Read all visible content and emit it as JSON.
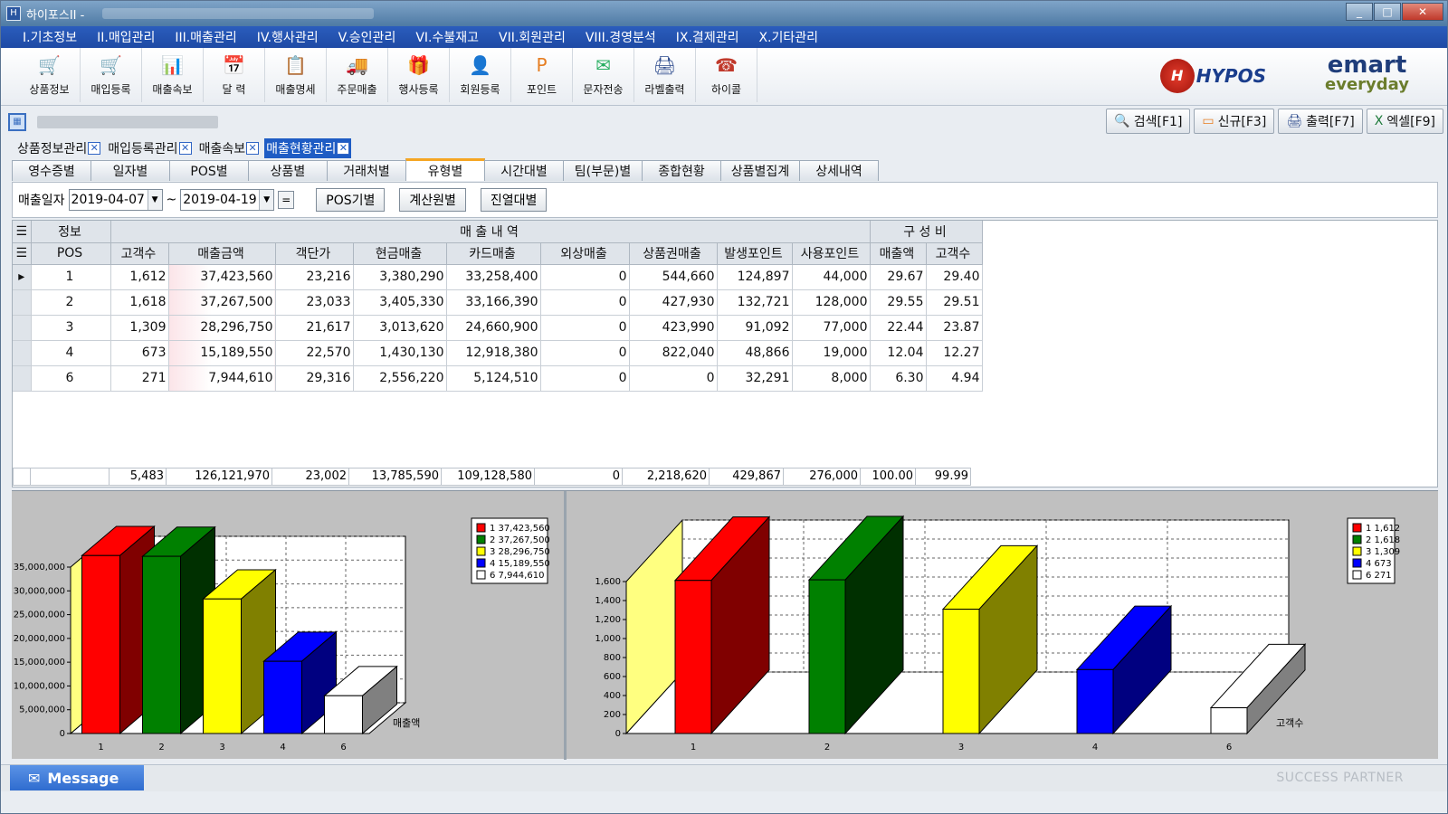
{
  "window": {
    "title": "하이포스II -",
    "controls": [
      "minimize",
      "maximize",
      "close"
    ]
  },
  "menu": [
    "I.기초정보",
    "II.매입관리",
    "III.매출관리",
    "IV.행사관리",
    "V.승인관리",
    "VI.수불재고",
    "VII.회원관리",
    "VIII.경영분석",
    "IX.결제관리",
    "X.기타관리"
  ],
  "toolbar": [
    {
      "label": "상품정보",
      "icon": "shop-basket-icon",
      "glyph": "🛒"
    },
    {
      "label": "매입등록",
      "icon": "cart-icon",
      "glyph": "🛒"
    },
    {
      "label": "매출속보",
      "icon": "chart-icon",
      "glyph": "📊"
    },
    {
      "label": "달  력",
      "icon": "calendar-icon",
      "glyph": "📅"
    },
    {
      "label": "매출명세",
      "icon": "clipboard-icon",
      "glyph": "📋"
    },
    {
      "label": "주문매출",
      "icon": "truck-icon",
      "glyph": "🚚"
    },
    {
      "label": "행사등록",
      "icon": "gift-icon",
      "glyph": "🎁"
    },
    {
      "label": "회원등록",
      "icon": "user-add-icon",
      "glyph": "👤"
    },
    {
      "label": "포인트",
      "icon": "point-coin-icon",
      "glyph": "P"
    },
    {
      "label": "문자전송",
      "icon": "envelope-icon",
      "glyph": "✉"
    },
    {
      "label": "라벨출력",
      "icon": "printer-icon",
      "glyph": "🖨"
    },
    {
      "label": "하이콜",
      "icon": "phone-icon",
      "glyph": "☎"
    }
  ],
  "logos": {
    "hypos_mark": "H",
    "hypos_text": "HYPOS",
    "emart_top": "emart",
    "emart_bottom": "everyday"
  },
  "actions": [
    {
      "label": "검색[F1]",
      "icon": "search-icon",
      "glyph": "🔍"
    },
    {
      "label": "신규[F3]",
      "icon": "new-doc-icon",
      "glyph": "▭"
    },
    {
      "label": "출력[F7]",
      "icon": "printer-icon",
      "glyph": "🖨"
    },
    {
      "label": "엑셀[F9]",
      "icon": "excel-icon",
      "glyph": "X"
    }
  ],
  "doc_tabs": [
    {
      "label": "상품정보관리",
      "active": false
    },
    {
      "label": "매입등록관리",
      "active": false
    },
    {
      "label": "매출속보",
      "active": false
    },
    {
      "label": "매출현황관리",
      "active": true
    }
  ],
  "sub_tabs": [
    {
      "label": "영수증별",
      "active": false
    },
    {
      "label": "일자별",
      "active": false
    },
    {
      "label": "POS별",
      "active": false
    },
    {
      "label": "상품별",
      "active": false
    },
    {
      "label": "거래처별",
      "active": false
    },
    {
      "label": "유형별",
      "active": true
    },
    {
      "label": "시간대별",
      "active": false
    },
    {
      "label": "팀(부문)별",
      "active": false
    },
    {
      "label": "종합현황",
      "active": false
    },
    {
      "label": "상품별집계",
      "active": false
    },
    {
      "label": "상세내역",
      "active": false
    }
  ],
  "filter": {
    "label": "매출일자",
    "date_from": "2019-04-07",
    "date_to": "2019-04-19",
    "tilde": "~",
    "eq": "=",
    "buttons": [
      "POS기별",
      "계산원별",
      "진열대별"
    ]
  },
  "grid": {
    "group_info": "정보",
    "group_sales": "매 출 내 역",
    "group_ratio": "구 성 비",
    "columns": [
      "POS",
      "고객수",
      "매출금액",
      "객단가",
      "현금매출",
      "카드매출",
      "외상매출",
      "상품권매출",
      "발생포인트",
      "사용포인트",
      "매출액",
      "고객수"
    ],
    "rows": [
      [
        "1",
        "1,612",
        "37,423,560",
        "23,216",
        "3,380,290",
        "33,258,400",
        "0",
        "544,660",
        "124,897",
        "44,000",
        "29.67",
        "29.40"
      ],
      [
        "2",
        "1,618",
        "37,267,500",
        "23,033",
        "3,405,330",
        "33,166,390",
        "0",
        "427,930",
        "132,721",
        "128,000",
        "29.55",
        "29.51"
      ],
      [
        "3",
        "1,309",
        "28,296,750",
        "21,617",
        "3,013,620",
        "24,660,900",
        "0",
        "423,990",
        "91,092",
        "77,000",
        "22.44",
        "23.87"
      ],
      [
        "4",
        "673",
        "15,189,550",
        "22,570",
        "1,430,130",
        "12,918,380",
        "0",
        "822,040",
        "48,866",
        "19,000",
        "12.04",
        "12.27"
      ],
      [
        "6",
        "271",
        "7,944,610",
        "29,316",
        "2,556,220",
        "5,124,510",
        "0",
        "0",
        "32,291",
        "8,000",
        "6.30",
        "4.94"
      ]
    ],
    "totals": [
      "",
      "5,483",
      "126,121,970",
      "23,002",
      "13,785,590",
      "109,128,580",
      "0",
      "2,218,620",
      "429,867",
      "276,000",
      "100.00",
      "99.99"
    ]
  },
  "colors": {
    "series": [
      "#ff0000",
      "#008000",
      "#ffff00",
      "#0000ff",
      "#ffffff"
    ],
    "series_dark": [
      "#800000",
      "#003000",
      "#808000",
      "#000080",
      "#808080"
    ],
    "menu_bg": "#1e4aa5",
    "active_tab": "#f5a623"
  },
  "chart_data": [
    {
      "type": "bar",
      "categories": [
        "1",
        "2",
        "3",
        "4",
        "6"
      ],
      "values": [
        37423560,
        37267500,
        28296750,
        15189550,
        7944610
      ],
      "ylim": [
        0,
        35000000
      ],
      "yticks": [
        "0",
        "5,000,000",
        "10,000,000",
        "15,000,000",
        "20,000,000",
        "25,000,000",
        "30,000,000",
        "35,000,000"
      ],
      "series_label": "매출액",
      "legend": [
        "1 37,423,560",
        "2 37,267,500",
        "3 28,296,750",
        "4 15,189,550",
        "6 7,944,610"
      ],
      "legend_position": "top-right",
      "grid": true
    },
    {
      "type": "bar",
      "categories": [
        "1",
        "2",
        "3",
        "4",
        "6"
      ],
      "values": [
        1612,
        1618,
        1309,
        673,
        271
      ],
      "ylim": [
        0,
        1600
      ],
      "yticks": [
        "0",
        "200",
        "400",
        "600",
        "800",
        "1,000",
        "1,200",
        "1,400",
        "1,600"
      ],
      "series_label": "고객수",
      "legend": [
        "1 1,612",
        "2 1,618",
        "3 1,309",
        "4 673",
        "6 271"
      ],
      "legend_position": "top-right",
      "grid": true
    }
  ],
  "status": {
    "message_label": "Message",
    "footer": "SUCCESS PARTNER"
  }
}
